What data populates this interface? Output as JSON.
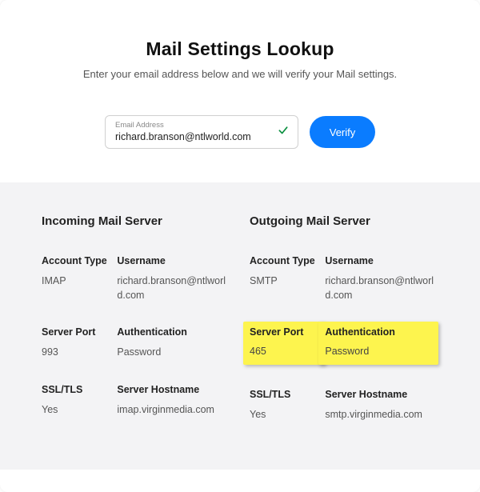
{
  "header": {
    "title": "Mail Settings Lookup",
    "subtitle": "Enter your email address below and we will verify your Mail settings.",
    "email_label": "Email Address",
    "email_value": "richard.branson@ntlworld.com",
    "verify_label": "Verify"
  },
  "incoming": {
    "heading": "Incoming Mail Server",
    "account_type_label": "Account Type",
    "account_type_value": "IMAP",
    "username_label": "Username",
    "username_value": "richard.branson@ntlworld.com",
    "server_port_label": "Server Port",
    "server_port_value": "993",
    "auth_label": "Authentication",
    "auth_value": "Password",
    "ssl_label": "SSL/TLS",
    "ssl_value": "Yes",
    "hostname_label": "Server Hostname",
    "hostname_value": "imap.virginmedia.com"
  },
  "outgoing": {
    "heading": "Outgoing Mail Server",
    "account_type_label": "Account Type",
    "account_type_value": "SMTP",
    "username_label": "Username",
    "username_value": "richard.branson@ntlworld.com",
    "server_port_label": "Server Port",
    "server_port_value": "465",
    "auth_label": "Authentication",
    "auth_value": "Password",
    "ssl_label": "SSL/TLS",
    "ssl_value": "Yes",
    "hostname_label": "Server Hostname",
    "hostname_value": "smtp.virginmedia.com"
  }
}
